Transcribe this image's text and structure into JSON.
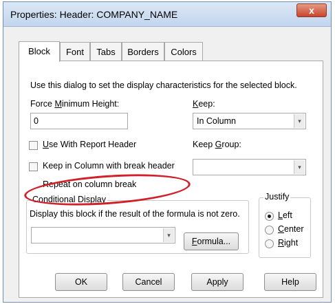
{
  "window": {
    "title": "Properties: Header: COMPANY_NAME",
    "close_label": "x"
  },
  "tabs": [
    {
      "label": "Block",
      "active": true
    },
    {
      "label": "Font"
    },
    {
      "label": "Tabs"
    },
    {
      "label": "Borders"
    },
    {
      "label": "Colors"
    }
  ],
  "panel": {
    "description": "Use this dialog to set the display characteristics for the selected block.",
    "force_min_height": {
      "label": "Force Minimum Height:",
      "value": "0"
    },
    "keep": {
      "label": "Keep:",
      "value": "In Column"
    },
    "use_with_report_header": {
      "label": "Use With Report Header",
      "checked": false
    },
    "keep_group": {
      "label": "Keep Group:",
      "value": ""
    },
    "keep_in_column": {
      "label": "Keep in Column with break header",
      "checked": false
    },
    "repeat_on_column_break": {
      "label": "Repeat on column break"
    },
    "conditional_display": {
      "label": "Conditional Display",
      "description": "Display this block if the result of the formula is not zero.",
      "formula_value": "",
      "formula_button": "Formula..."
    },
    "justify": {
      "label": "Justify",
      "options": [
        "Left",
        "Center",
        "Right"
      ],
      "selected": "Left"
    }
  },
  "buttons": {
    "ok": "OK",
    "cancel": "Cancel",
    "apply": "Apply",
    "help": "Help"
  },
  "colors": {
    "annotation": "#d0202a",
    "title_bar": "#c3d6ee",
    "close": "#c8452c"
  }
}
